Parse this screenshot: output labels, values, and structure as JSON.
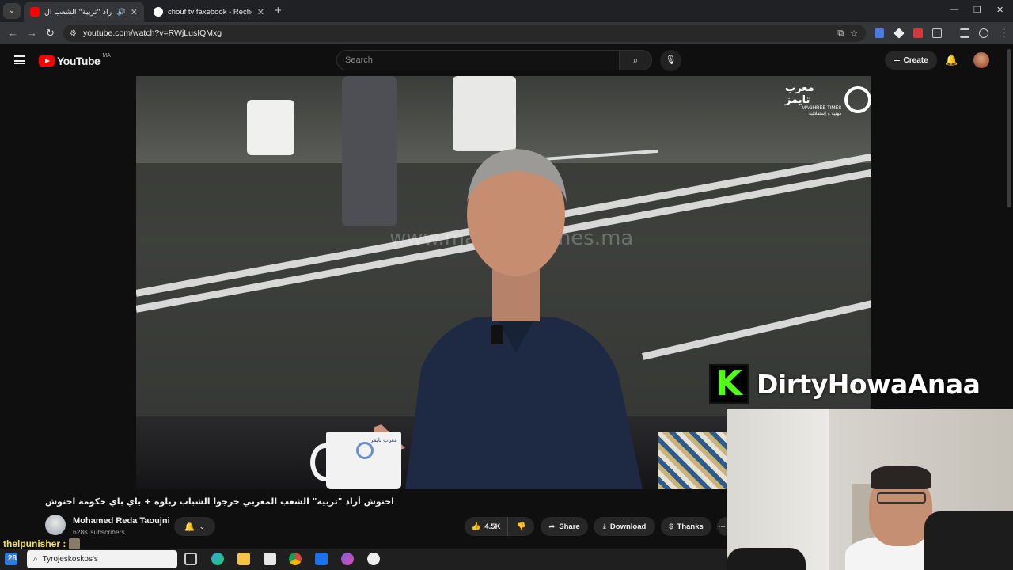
{
  "browser": {
    "tabs": [
      {
        "label": "اخنوش أراد \"تربية\" الشعب ال...",
        "active": true,
        "audio": "🔊"
      },
      {
        "label": "chouf tv faxebook - Recherche",
        "active": false
      }
    ],
    "new_tab": "+",
    "url": "youtube.com/watch?v=RWjLusIQMxg",
    "window_controls": {
      "minimize": "—",
      "restore": "❐",
      "close": "✕"
    }
  },
  "youtube": {
    "logo_text": "YouTube",
    "country_code": "MA",
    "search_placeholder": "Search",
    "create_label": "Create"
  },
  "video": {
    "channel_logo_ar": "مغرب تايمز",
    "channel_logo_en": "MAGHREB TIMES",
    "channel_logo_tagline": "مهنية و إستقلالية",
    "watermark": "www.maghrebtimes.ma",
    "mug_text": "مغرب تايمز"
  },
  "stream_overlay": {
    "brand_letter": "K",
    "brand_name": "DirtyHowaAnaa",
    "brand_color": "#53fc18",
    "chat_user": "thelpunisher :"
  },
  "info": {
    "title": "اخنوش أراد \"تربية\" الشعب المغربي خرجوا الشباب رباوه + باي باي حكومة اخنوش",
    "channel_name": "Mohamed Reda Taoujni",
    "subscribers": "628K subscribers",
    "likes": "4.5K",
    "share": "Share",
    "download": "Download",
    "thanks": "Thanks",
    "more": "⋯"
  },
  "taskbar": {
    "search_text": "Tyrojeskoskos's",
    "counter": "28"
  }
}
